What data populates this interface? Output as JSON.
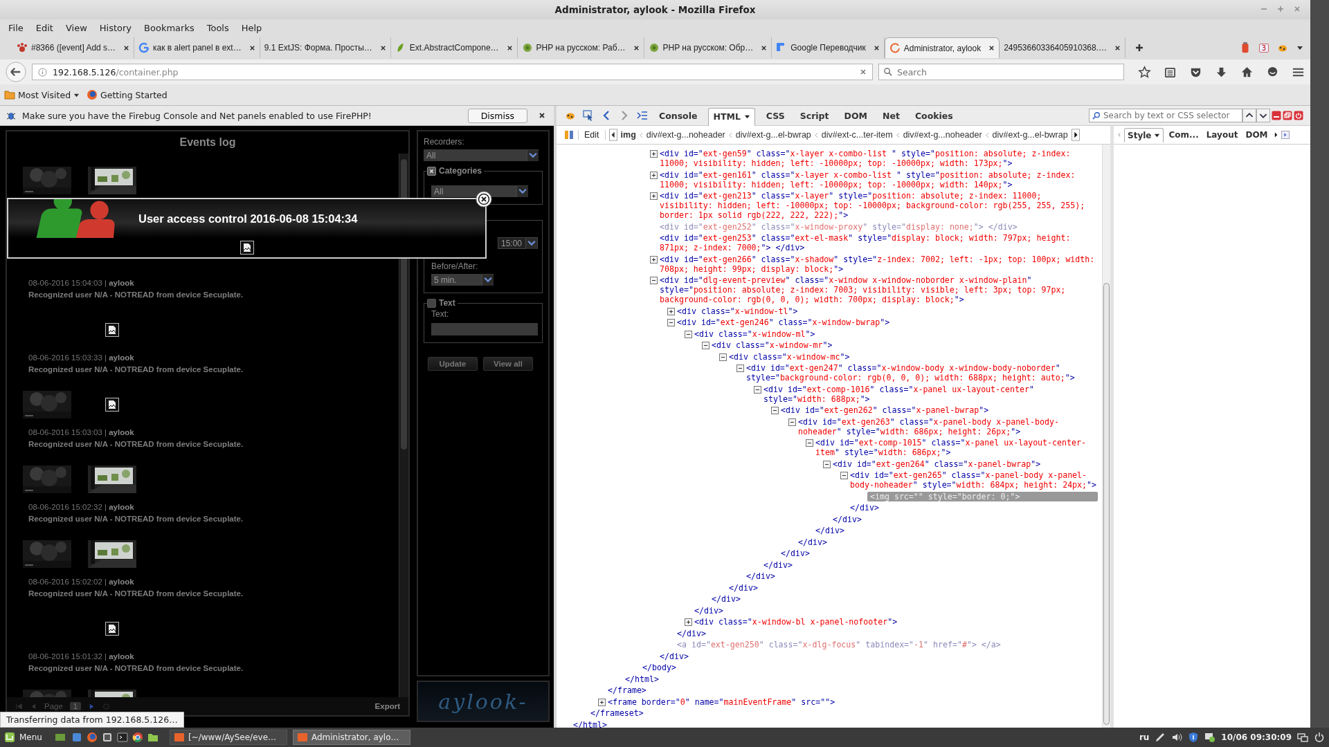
{
  "window": {
    "title": "Administrator, aylook - Mozilla Firefox"
  },
  "menu": [
    "File",
    "Edit",
    "View",
    "History",
    "Bookmarks",
    "Tools",
    "Help"
  ],
  "tabs": [
    {
      "title": "#8366 ([event] Add s…",
      "kind": "paw",
      "selected": false
    },
    {
      "title": "как в alert panel в ext…",
      "kind": "google",
      "selected": false
    },
    {
      "title": "9.1 ExtJS: Форма. Просты…",
      "kind": "none",
      "selected": false
    },
    {
      "title": "Ext.AbstractCompone…",
      "kind": "leaf",
      "selected": false
    },
    {
      "title": "PHP на русском: Раб…",
      "kind": "flower",
      "selected": false
    },
    {
      "title": "PHP на русском: Обр…",
      "kind": "flower",
      "selected": false
    },
    {
      "title": "Google Переводчик",
      "kind": "translate",
      "selected": false
    },
    {
      "title": "Administrator, aylook",
      "kind": "loading",
      "selected": true
    },
    {
      "title": "24953660336405910368.…",
      "kind": "none",
      "selected": false
    }
  ],
  "extension_badge": "3",
  "address": {
    "host": "192.168.5.126",
    "path": "/container.php"
  },
  "search": {
    "placeholder": "Search"
  },
  "bookmarks": [
    {
      "label": "Most Visited",
      "kind": "folder"
    },
    {
      "label": "Getting Started",
      "kind": "firefox"
    }
  ],
  "notification": {
    "text": "Make sure you have the Firebug Console and Net panels enabled to use FirePHP!",
    "button": "Dismiss"
  },
  "events_log": {
    "title": "Events log",
    "events": [
      {
        "images": [
          {
            "kind": "dark"
          },
          {
            "kind": "window"
          }
        ]
      },
      {
        "time": "08-06-2016 15:04:03 | **aylook**",
        "description": "Recognized user N/A - NOTREAD from device Secuplate."
      },
      {
        "images": [
          {
            "kind": "none"
          },
          {
            "kind": "broken"
          }
        ],
        "time": "08-06-2016 15:03:33 | **aylook**",
        "description": "Recognized user N/A - NOTREAD from device Secuplate."
      },
      {
        "images": [
          {
            "kind": "dark"
          },
          {
            "kind": "broken"
          }
        ],
        "time": "08-06-2016 15:03:03 | **aylook**",
        "description": "Recognized user N/A - NOTREAD from device Secuplate."
      },
      {
        "images": [
          {
            "kind": "dark"
          },
          {
            "kind": "window"
          }
        ],
        "time": "08-06-2016 15:02:32 | **aylook**",
        "description": "Recognized user N/A - NOTREAD from device Secuplate."
      },
      {
        "images": [
          {
            "kind": "dark"
          },
          {
            "kind": "window"
          }
        ],
        "time": "08-06-2016 15:02:02 | **aylook**",
        "description": "Recognized user N/A - NOTREAD from device Secuplate."
      },
      {
        "images": [
          {
            "kind": "none"
          },
          {
            "kind": "broken"
          }
        ],
        "time": "08-06-2016 15:01:32 | **aylook**",
        "description": "Recognized user N/A - NOTREAD from device Secuplate."
      },
      {
        "images": [
          {
            "kind": "dark"
          },
          {
            "kind": "window"
          }
        ]
      }
    ],
    "pager": {
      "label": "Page",
      "value": "1"
    },
    "export": "Export"
  },
  "popup": {
    "title": "User access control 2016-06-08 15:04:34"
  },
  "filters": {
    "recorders_label": "Recorders:",
    "recorders": "All",
    "categories": {
      "legend": "Categories",
      "checked": true,
      "value": "All"
    },
    "time": {
      "value": "15:00",
      "before_after_label": "Before/After:",
      "before_after": "5 min."
    },
    "text": {
      "legend": "Text",
      "checked": false,
      "label": "Text:"
    },
    "buttons": [
      "Update",
      "View all"
    ]
  },
  "logo": "aylook-",
  "status_tooltip": "Transferring data from 192.168.5.126…",
  "firebug": {
    "tabs": [
      {
        "label": "Console",
        "selected": false
      },
      {
        "label": "HTML",
        "selected": true
      },
      {
        "label": "CSS",
        "selected": false
      },
      {
        "label": "Script",
        "selected": false
      },
      {
        "label": "DOM",
        "selected": false
      },
      {
        "label": "Net",
        "selected": false
      },
      {
        "label": "Cookies",
        "selected": false
      }
    ],
    "search_placeholder": "Search by text or CSS selector",
    "edit": "Edit",
    "breadcrumbs": [
      {
        "label": "img",
        "selected": true
      },
      {
        "label": "div#ext-g...noheader",
        "selected": false
      },
      {
        "label": "div#ext-g...el-bwrap",
        "selected": false
      },
      {
        "label": "div#ext-c...ter-item",
        "selected": false
      },
      {
        "label": "div#ext-g...noheader",
        "selected": false
      },
      {
        "label": "div#ext-g...el-bwrap",
        "selected": false
      }
    ],
    "side_tabs": [
      {
        "label": "Style",
        "selected": true
      },
      {
        "label": "Com...",
        "selected": false
      },
      {
        "label": "Layout",
        "selected": false
      },
      {
        "label": "DOM",
        "selected": false
      }
    ],
    "html_tree": {
      "close": "</html>",
      "children": [
        {
          "close": "</frameset>",
          "children": [
            {
              "close": "</frame>",
              "children": [
                {
                  "close": "</html>",
                  "children": [
                    {
                      "close": "</body>",
                      "children": [
                        {
                          "open": "<div id=\"ext-gen59\" class=\"x-layer x-combo-list \" style=\"position: absolute; z-index: 11000; visibility: hidden; left: -10000px; top: -10000px; width: 173px;\">",
                          "expanded": false,
                          "selected": false,
                          "dimmed": false
                        },
                        {
                          "open": "<div id=\"ext-gen161\" class=\"x-layer x-combo-list \" style=\"position: absolute; z-index: 11000; visibility: hidden; left: -10000px; top: -10000px; width: 140px;\">",
                          "expanded": false,
                          "selected": false,
                          "dimmed": false
                        },
                        {
                          "open": "<div id=\"ext-gen213\" class=\"x-layer\" style=\"position: absolute; z-index: 11000; visibility: hidden; left: -10000px; top: -10000px; background-color: rgb(255, 255, 255); border: 1px solid rgb(222, 222, 222);\">",
                          "expanded": false,
                          "selected": false,
                          "dimmed": false
                        },
                        {
                          "open": "<div id=\"ext-gen252\" class=\"x-window-proxy\" style=\"display: none;\"> </div>",
                          "selected": false,
                          "dimmed": true
                        },
                        {
                          "open": "<div id=\"ext-gen253\" class=\"ext-el-mask\" style=\"display: block; width: 797px; height: 871px; z-index: 7000;\"> </div>",
                          "selected": false,
                          "dimmed": false
                        },
                        {
                          "open": "<div id=\"ext-gen266\" class=\"x-shadow\" style=\"z-index: 7002; left: -1px; top: 100px; width: 708px; height: 99px; display: block;\">",
                          "expanded": false,
                          "selected": false,
                          "dimmed": false
                        },
                        {
                          "open": "<div id=\"dlg-event-preview\" class=\"x-window x-window-noborder x-window-plain\" style=\"position: absolute; z-index: 7003; visibility: visible; left: 3px; top: 97px; background-color: rgb(0, 0, 0); width: 700px; display: block;\">",
                          "expanded": true,
                          "selected": false,
                          "dimmed": false,
                          "close": "</div>",
                          "children": [
                            {
                              "open": "<div class=\"x-window-tl\">",
                              "expanded": false,
                              "selected": false,
                              "dimmed": false
                            },
                            {
                              "open": "<div id=\"ext-gen246\" class=\"x-window-bwrap\">",
                              "expanded": true,
                              "selected": false,
                              "dimmed": false,
                              "close": "</div>",
                              "children": [
                                {
                                  "open": "<div class=\"x-window-ml\">",
                                  "expanded": true,
                                  "selected": false,
                                  "dimmed": false,
                                  "close": "</div>",
                                  "children": [
                                    {
                                      "open": "<div class=\"x-window-mr\">",
                                      "expanded": true,
                                      "selected": false,
                                      "dimmed": false,
                                      "close": "</div>",
                                      "children": [
                                        {
                                          "open": "<div class=\"x-window-mc\">",
                                          "expanded": true,
                                          "selected": false,
                                          "dimmed": false,
                                          "close": "</div>",
                                          "children": [
                                            {
                                              "open": "<div id=\"ext-gen247\" class=\"x-window-body x-window-body-noborder\" style=\"background-color: rgb(0, 0, 0); width: 688px; height: auto;\">",
                                              "expanded": true,
                                              "selected": false,
                                              "dimmed": false,
                                              "close": "</div>",
                                              "children": [
                                                {
                                                  "open": "<div id=\"ext-comp-1016\" class=\"x-panel ux-layout-center\" style=\"width: 688px;\">",
                                                  "expanded": true,
                                                  "selected": false,
                                                  "dimmed": false,
                                                  "close": "</div>",
                                                  "children": [
                                                    {
                                                      "open": "<div id=\"ext-gen262\" class=\"x-panel-bwrap\">",
                                                      "expanded": true,
                                                      "selected": false,
                                                      "dimmed": false,
                                                      "close": "</div>",
                                                      "children": [
                                                        {
                                                          "open": "<div id=\"ext-gen263\" class=\"x-panel-body x-panel-body-noheader\" style=\"width: 686px; height: 26px;\">",
                                                          "expanded": true,
                                                          "selected": false,
                                                          "dimmed": false,
                                                          "close": "</div>",
                                                          "children": [
                                                            {
                                                              "open": "<div id=\"ext-comp-1015\" class=\"x-panel ux-layout-center-item\" style=\"width: 686px;\">",
                                                              "expanded": true,
                                                              "selected": false,
                                                              "dimmed": false,
                                                              "close": "</div>",
                                                              "children": [
                                                                {
                                                                  "open": "<div id=\"ext-gen264\" class=\"x-panel-bwrap\">",
                                                                  "expanded": true,
                                                                  "selected": false,
                                                                  "dimmed": false,
                                                                  "close": "</div>",
                                                                  "children": [
                                                                    {
                                                                      "open": "<div id=\"ext-gen265\" class=\"x-panel-body x-panel-body-noheader\" style=\"width: 684px; height: 24px;\">",
                                                                      "expanded": true,
                                                                      "selected": false,
                                                                      "dimmed": false,
                                                                      "close": "</div>",
                                                                      "children": [
                                                                        {
                                                                          "open": "<img src=\"\" style=\"border: 0;\">",
                                                                          "selected": true,
                                                                          "dimmed": false
                                                                        }
                                                                      ]
                                                                    }
                                                                  ]
                                                                }
                                                              ]
                                                            }
                                                          ]
                                                        }
                                                      ]
                                                    }
                                                  ]
                                                }
                                              ]
                                            }
                                          ]
                                        }
                                      ]
                                    }
                                  ]
                                },
                                {
                                  "open": "<div class=\"x-window-bl x-panel-nofooter\">",
                                  "expanded": false,
                                  "selected": false,
                                  "dimmed": false
                                }
                              ]
                            },
                            {
                              "open": "<a id=\"ext-gen250\" class=\"x-dlg-focus\" tabindex=\"-1\" href=\"#\"> </a>",
                              "selected": false,
                              "dimmed": true
                            }
                          ]
                        }
                      ]
                    }
                  ]
                }
              ]
            },
            {
              "open": "<frame border=\"0\" name=\"mainEventFrame\" src=\"\">",
              "expanded": false,
              "selected": false,
              "dimmed": false
            }
          ]
        }
      ]
    }
  },
  "taskbar": {
    "menu": "Menu",
    "tasks": [
      {
        "title": "[~/www/AySee/eve…",
        "selected": false
      },
      {
        "title": "Administrator, aylo…",
        "selected": true
      }
    ],
    "language": "ru",
    "clock": "10/06 09:30:09"
  }
}
